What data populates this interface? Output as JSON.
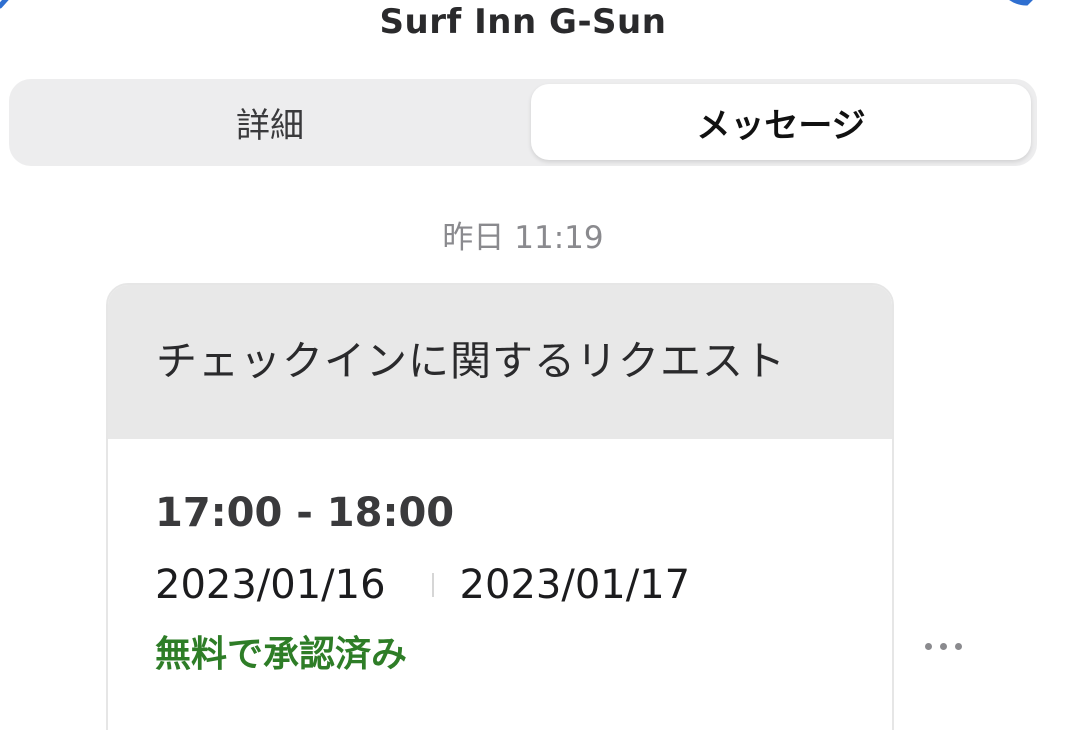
{
  "header": {
    "title": "Surf Inn G-Sun",
    "back_icon": "chevron-left-icon",
    "call_icon": "phone-icon"
  },
  "tabs": [
    {
      "label": "詳細",
      "selected": false
    },
    {
      "label": "メッセージ",
      "selected": true
    }
  ],
  "message": {
    "timestamp": "昨日 11:19",
    "card": {
      "title": "チェックインに関するリクエスト",
      "time_range": "17:00 - 18:00",
      "date_from": "2023/01/16",
      "date_to": "2023/01/17",
      "status": "無料で承認済み"
    },
    "more_icon": "more-horizontal-icon"
  },
  "colors": {
    "accent": "#2f6fd0",
    "status_approved": "#2e7d27",
    "segmented_bg": "#ededee",
    "card_header_bg": "#e8e8e8"
  }
}
